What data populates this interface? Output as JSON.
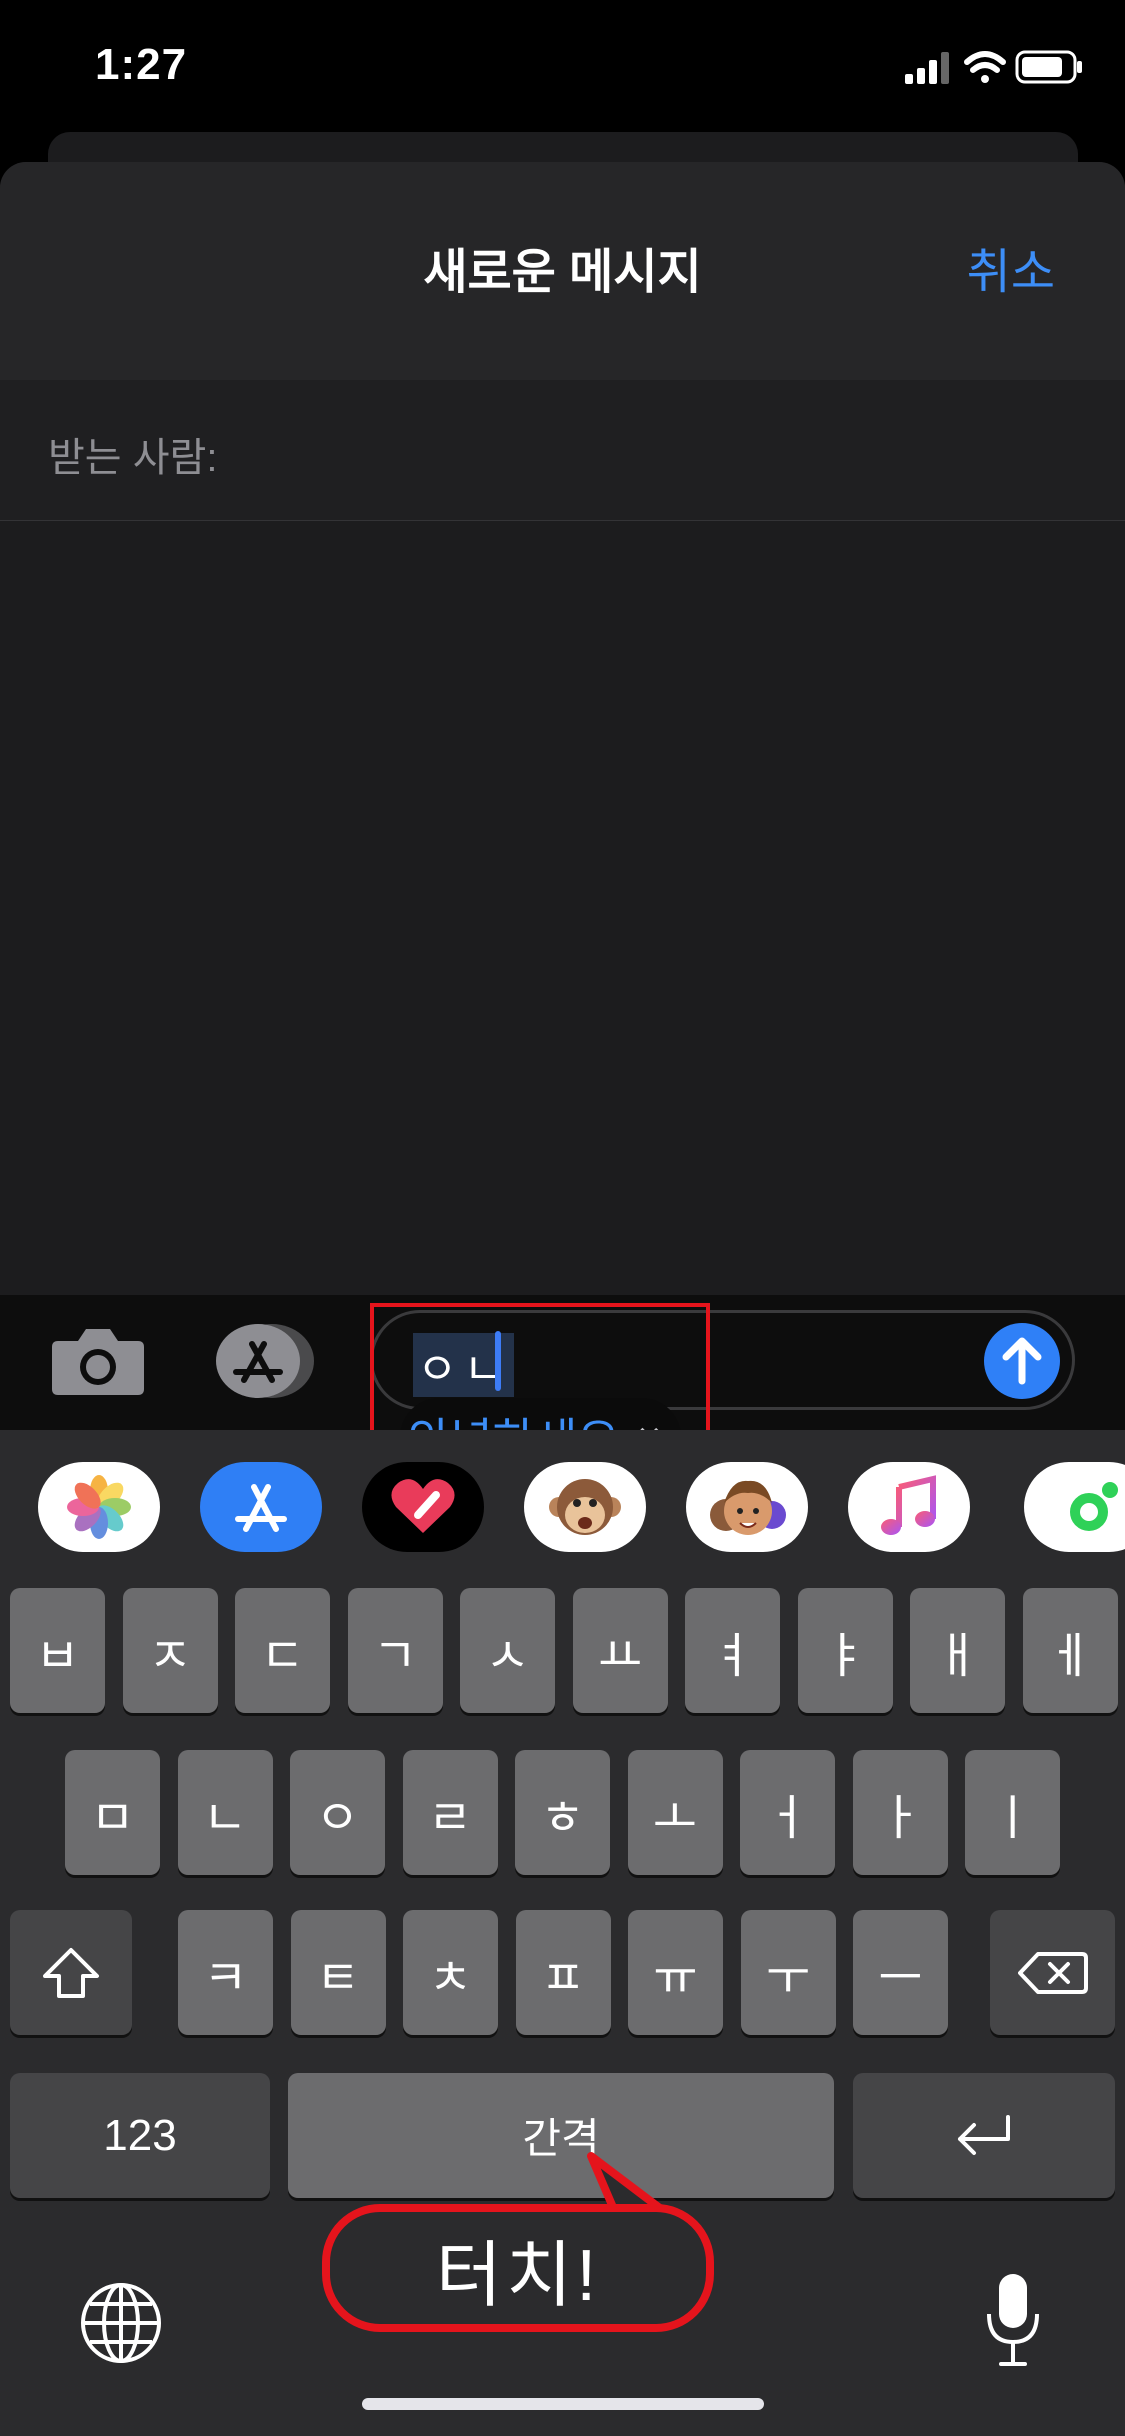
{
  "status_bar": {
    "time": "1:27"
  },
  "nav": {
    "title": "새로운 메시지",
    "cancel_label": "취소"
  },
  "recipient": {
    "label": "받는 사람:"
  },
  "composer": {
    "text": "ㅇㄴ",
    "suggestion": "안녕하세요",
    "suggestion_dismiss": "×"
  },
  "app_strip": {
    "items": [
      "photos-app",
      "app-store-app",
      "digital-touch-app",
      "animoji-app",
      "memoji-app",
      "music-app",
      "fitness-app"
    ]
  },
  "keyboard": {
    "row1": [
      "ㅂ",
      "ㅈ",
      "ㄷ",
      "ㄱ",
      "ㅅ",
      "ㅛ",
      "ㅕ",
      "ㅑ",
      "ㅐ",
      "ㅔ"
    ],
    "row2": [
      "ㅁ",
      "ㄴ",
      "ㅇ",
      "ㄹ",
      "ㅎ",
      "ㅗ",
      "ㅓ",
      "ㅏ",
      "ㅣ"
    ],
    "row3": [
      "ㅋ",
      "ㅌ",
      "ㅊ",
      "ㅍ",
      "ㅠ",
      "ㅜ",
      "ㅡ"
    ],
    "numbers_label": "123",
    "space_label": "간격"
  },
  "annotation": {
    "callout_text": "터치!"
  },
  "colors": {
    "accent": "#3d8ef7",
    "annotation": "#e5141c",
    "key": "#6c6c6e",
    "key_dark": "#454547"
  }
}
